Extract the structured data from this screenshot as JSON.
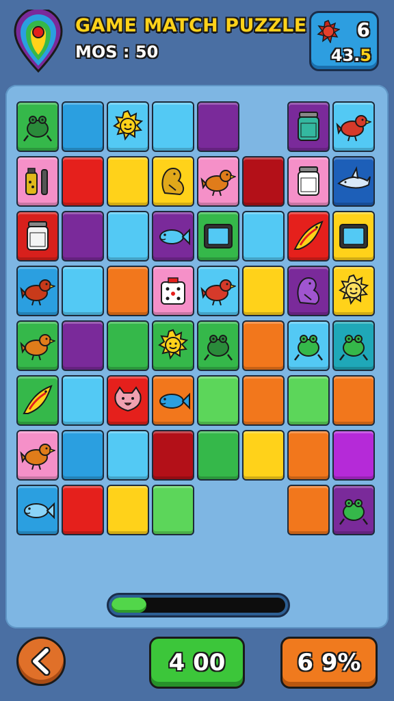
{
  "header": {
    "title": "GAME MATCH PUZZLE",
    "moves_text": "MOS : 50",
    "logo_icon": "rainbow-drop-logo-icon"
  },
  "score": {
    "icon": "red-sun-gem-icon",
    "top_value": "6",
    "bottom_prefix": "43.",
    "bottom_accent": "5"
  },
  "board": {
    "rows": 8,
    "cols": 8,
    "tiles": [
      [
        {
          "bg": "#35b84a",
          "icon": "frog-icon",
          "fg": "#2a8a3a"
        },
        {
          "bg": "#2b9fe0"
        },
        {
          "bg": "#53c9f4",
          "icon": "sun-icon",
          "fg": "#ffd21a"
        },
        {
          "bg": "#53c9f4"
        },
        {
          "bg": "#7a2a9a"
        },
        {
          "bg": "empty"
        },
        {
          "bg": "#7a2a9a",
          "icon": "jar-icon",
          "fg": "#34b8a0"
        },
        {
          "bg": "#53c9f4",
          "icon": "bird-icon",
          "fg": "#d63a2a"
        }
      ],
      [
        {
          "bg": "#f590c8",
          "icon": "bottle-icon",
          "fg": "#e0b81a"
        },
        {
          "bg": "#e5201c"
        },
        {
          "bg": "#ffd21a"
        },
        {
          "bg": "#ffd21a",
          "icon": "squirrel-icon",
          "fg": "#e0a81a"
        },
        {
          "bg": "#f590c8",
          "icon": "bird-icon",
          "fg": "#e07c1a"
        },
        {
          "bg": "#b31018"
        },
        {
          "bg": "#f590c8",
          "icon": "jar-icon",
          "fg": "#ffffff"
        },
        {
          "bg": "#1d5fb8",
          "icon": "shark-icon",
          "fg": "#d8e8f8"
        }
      ],
      [
        {
          "bg": "#d8201c",
          "icon": "jar-icon",
          "fg": "#f4f4f4"
        },
        {
          "bg": "#7a2a9a"
        },
        {
          "bg": "#53c9f4"
        },
        {
          "bg": "#7a2a9a",
          "icon": "fish-icon",
          "fg": "#53c9f4"
        },
        {
          "bg": "#35b84a",
          "icon": "screen-icon",
          "fg": "#53c9f4"
        },
        {
          "bg": "#53c9f4"
        },
        {
          "bg": "#e5201c",
          "icon": "flame-bird-icon",
          "fg": "#ffd21a"
        },
        {
          "bg": "#ffd21a",
          "icon": "screen-icon",
          "fg": "#53c9f4"
        }
      ],
      [
        {
          "bg": "#2b9fe0",
          "icon": "bird-icon",
          "fg": "#c83a1a"
        },
        {
          "bg": "#53c9f4"
        },
        {
          "bg": "#f2771c"
        },
        {
          "bg": "#f590c8",
          "icon": "dice-icon",
          "fg": "#ffffff"
        },
        {
          "bg": "#53c9f4",
          "icon": "bird-icon",
          "fg": "#d63a2a"
        },
        {
          "bg": "#ffd21a"
        },
        {
          "bg": "#7a2a9a",
          "icon": "squirrel-icon",
          "fg": "#a055d0"
        },
        {
          "bg": "#ffd21a",
          "icon": "sun-icon",
          "fg": "#ffe060"
        }
      ],
      [
        {
          "bg": "#35b84a",
          "icon": "bird-icon",
          "fg": "#e07c1a"
        },
        {
          "bg": "#7a2a9a"
        },
        {
          "bg": "#35b84a"
        },
        {
          "bg": "#35b84a",
          "icon": "sun-icon",
          "fg": "#ffd21a"
        },
        {
          "bg": "#35b84a",
          "icon": "frog-icon",
          "fg": "#2a8a3a"
        },
        {
          "bg": "#f2771c"
        },
        {
          "bg": "#53c9f4",
          "icon": "frog-icon",
          "fg": "#35b84a"
        },
        {
          "bg": "#1fa8b8",
          "icon": "frog-icon",
          "fg": "#35b84a"
        }
      ],
      [
        {
          "bg": "#35b84a",
          "icon": "flame-bird-icon",
          "fg": "#ffd21a"
        },
        {
          "bg": "#53c9f4"
        },
        {
          "bg": "#e5201c",
          "icon": "cat-face-icon",
          "fg": "#f0a0b0"
        },
        {
          "bg": "#f2771c",
          "icon": "fish-icon",
          "fg": "#2b9fe0"
        },
        {
          "bg": "#5cd65a"
        },
        {
          "bg": "#f2771c"
        },
        {
          "bg": "#5cd65a"
        },
        {
          "bg": "#f2771c"
        }
      ],
      [
        {
          "bg": "#f590c8",
          "icon": "bird-icon",
          "fg": "#e07c1a"
        },
        {
          "bg": "#2b9fe0"
        },
        {
          "bg": "#53c9f4"
        },
        {
          "bg": "#b31018"
        },
        {
          "bg": "#35b84a"
        },
        {
          "bg": "#ffd21a"
        },
        {
          "bg": "#f2771c"
        },
        {
          "bg": "#b52ad8"
        }
      ],
      [
        {
          "bg": "#2b9fe0",
          "icon": "fish-icon",
          "fg": "#8ad4f8"
        },
        {
          "bg": "#e5201c"
        },
        {
          "bg": "#ffd21a"
        },
        {
          "bg": "#5cd65a"
        },
        {
          "bg": "empty"
        },
        {
          "bg": "empty"
        },
        {
          "bg": "#f2771c"
        },
        {
          "bg": "#7a2a9a",
          "icon": "frog-icon",
          "fg": "#35b84a"
        }
      ]
    ]
  },
  "progress": {
    "fraction": 0.2
  },
  "footer": {
    "back_icon": "chevron-left-icon",
    "moves_label": "4 00",
    "percent_label": "6 9%"
  }
}
